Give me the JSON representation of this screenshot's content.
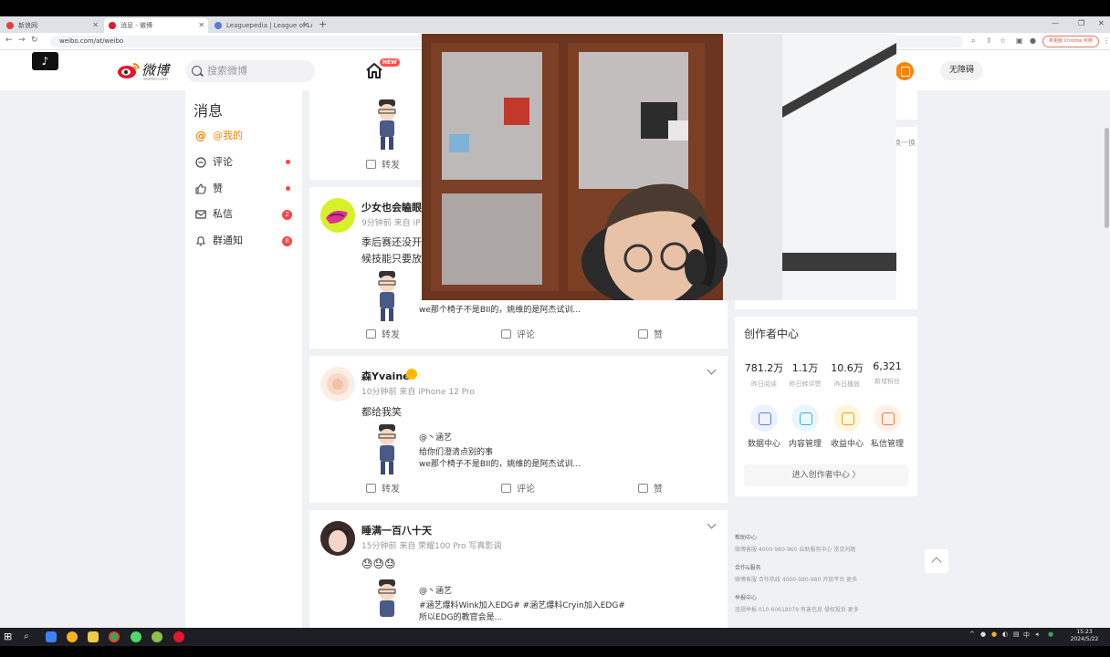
{
  "browser": {
    "tabs": [
      {
        "title": "新浪网"
      },
      {
        "title": "消息 - 微博"
      },
      {
        "title": "Leaguepedia | League of Leg..."
      }
    ],
    "url": "weibo.com/at/weibo",
    "profile_chip": "新更版 Chrome 可用"
  },
  "header": {
    "logo_text": "微博",
    "logo_sub": "weibo.com",
    "search_placeholder": "搜索微博",
    "home_badge": "NEW",
    "a11y_label": "无障碍"
  },
  "sidebar": {
    "title": "消息",
    "items": [
      {
        "label": "@我的",
        "icon": "at-icon",
        "active": true
      },
      {
        "label": "评论",
        "icon": "comment-icon",
        "dot": true
      },
      {
        "label": "赞",
        "icon": "like-icon",
        "dot": true
      },
      {
        "label": "私信",
        "icon": "mail-icon",
        "count": "2"
      },
      {
        "label": "群通知",
        "icon": "bell-icon",
        "count": "8"
      }
    ]
  },
  "feed": {
    "action_labels": {
      "repost": "转发",
      "comment": "评论",
      "like": "赞"
    },
    "posts": [
      {
        "username": "少女也会瞌眼",
        "meta": "9分钟前 来自 iP",
        "lines": [
          "季后赛还没开",
          "候技能只要放"
        ],
        "quote": [
          "we那个椅子不是BII的，姚维的是阿杰试训..."
        ]
      },
      {
        "username": "森Yvaine",
        "meta": "10分钟前 来自 iPhone 12 Pro",
        "lines": [
          "都给我笑"
        ],
        "quote_user": "@丶涵艺",
        "quote": [
          "给你们澄清点别的事",
          "we那个椅子不是BII的，姚维的是阿杰试训..."
        ]
      },
      {
        "username": "睡满一百八十天",
        "meta": "15分钟前 来自 荣耀100 Pro 写真影调",
        "lines": [
          "😓😓😓"
        ],
        "quote_user": "@丶涵艺",
        "quote": [
          "#涵艺爆料Wink加入EDG# #涵艺爆料Cryin加入EDG#",
          "所以EDG的教官会是..."
        ]
      }
    ]
  },
  "creator": {
    "title": "创作者中心",
    "stats": [
      {
        "value": "781.2万",
        "label": "昨日阅读"
      },
      {
        "value": "1.1万",
        "label": "昨日转评赞"
      },
      {
        "value": "10.6万",
        "label": "昨日播放"
      },
      {
        "value": "6,321",
        "label": "新增粉丝"
      }
    ],
    "tools": [
      {
        "label": "数据中心",
        "color": "#5b7cf0",
        "bg": "#eef1ff"
      },
      {
        "label": "内容管理",
        "color": "#3bb0e0",
        "bg": "#e9f7fd"
      },
      {
        "label": "收益中心",
        "color": "#f0a400",
        "bg": "#fff6e0"
      },
      {
        "label": "私信管理",
        "color": "#f07a3b",
        "bg": "#fff0e8"
      }
    ],
    "enter_label": "进入创作者中心  〉",
    "switch_label": "换一换"
  },
  "footer": {
    "rows": [
      {
        "head": "帮助中心",
        "text": "微博客服 4000-960-960      自助服务中心      常见问题"
      },
      {
        "head": "合作&服务",
        "text": "微博客服    合作热线 4000-980-980    开放平台    更多"
      },
      {
        "head": "举报中心",
        "text": "违规举报 010-60618079    有害信息    侵权投诉    更多"
      }
    ]
  },
  "taskbar": {
    "time": "15:23",
    "date": "2024/5/22",
    "ime": "中"
  }
}
